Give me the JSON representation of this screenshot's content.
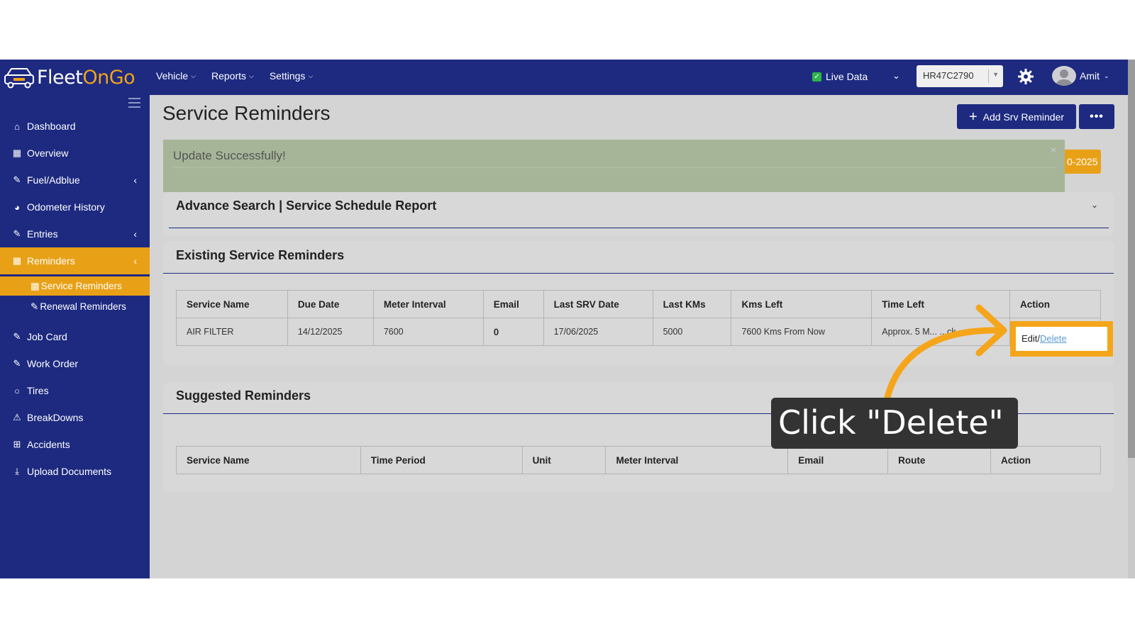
{
  "app": {
    "logo_part1": "Fleet",
    "logo_part2": "OnGo",
    "nav": [
      {
        "label": "Vehicle"
      },
      {
        "label": "Reports"
      },
      {
        "label": "Settings"
      }
    ],
    "live_data_label": "Live Data",
    "vehicle_select_value": "HR47C2790",
    "user_name": "Amit"
  },
  "sidebar": {
    "items": [
      {
        "label": "Dashboard",
        "icon": "home-icon"
      },
      {
        "label": "Overview",
        "icon": "grid-icon"
      },
      {
        "label": "Fuel/Adblue",
        "icon": "edit-icon"
      },
      {
        "label": "Odometer History",
        "icon": "gauge-icon"
      },
      {
        "label": "Entries",
        "icon": "edit-icon"
      },
      {
        "label": "Reminders",
        "icon": "calendar-icon"
      },
      {
        "label": "Job Card",
        "icon": "edit-icon"
      },
      {
        "label": "Work Order",
        "icon": "edit-icon"
      },
      {
        "label": "Tires",
        "icon": "circle-icon"
      },
      {
        "label": "BreakDowns",
        "icon": "warning-icon"
      },
      {
        "label": "Accidents",
        "icon": "plus-square-icon"
      },
      {
        "label": "Upload Documents",
        "icon": "download-icon"
      }
    ],
    "sub_items": [
      {
        "label": "Service Reminders"
      },
      {
        "label": "Renewal Reminders"
      }
    ]
  },
  "page": {
    "title": "Service Reminders",
    "add_button_label": "Add Srv Reminder",
    "more_button_label": "•••",
    "year_badge": "0-2025",
    "alert_message": "Update Successfully!",
    "alert_close": "×"
  },
  "advance_search": {
    "title": "Advance Search | Service Schedule Report"
  },
  "existing": {
    "title": "Existing Service Reminders",
    "columns": [
      "Service Name",
      "Due Date",
      "Meter Interval",
      "Email",
      "Last SRV Date",
      "Last KMs",
      "Kms Left",
      "Time Left",
      "Action"
    ],
    "rows": [
      {
        "service_name": "AIR FILTER",
        "due_date": "14/12/2025",
        "meter_interval": "7600",
        "email": "0",
        "last_srv_date": "17/06/2025",
        "last_kms": "5000",
        "kms_left": "7600 Kms From Now",
        "time_left": "Approx. 5 M... ...ck",
        "action_edit": "Edit",
        "action_sep": "/",
        "action_delete": "Delete"
      }
    ]
  },
  "suggested": {
    "title": "Suggested Reminders",
    "columns": [
      "Service Name",
      "Time Period",
      "Unit",
      "Meter Interval",
      "Email",
      "Route",
      "Action"
    ]
  },
  "tutorial": {
    "tooltip_text": "Click \"Delete\"",
    "highlight_color": "#f5a51a"
  },
  "colors": {
    "navy": "#1d2a80",
    "accent": "#e8a117"
  }
}
